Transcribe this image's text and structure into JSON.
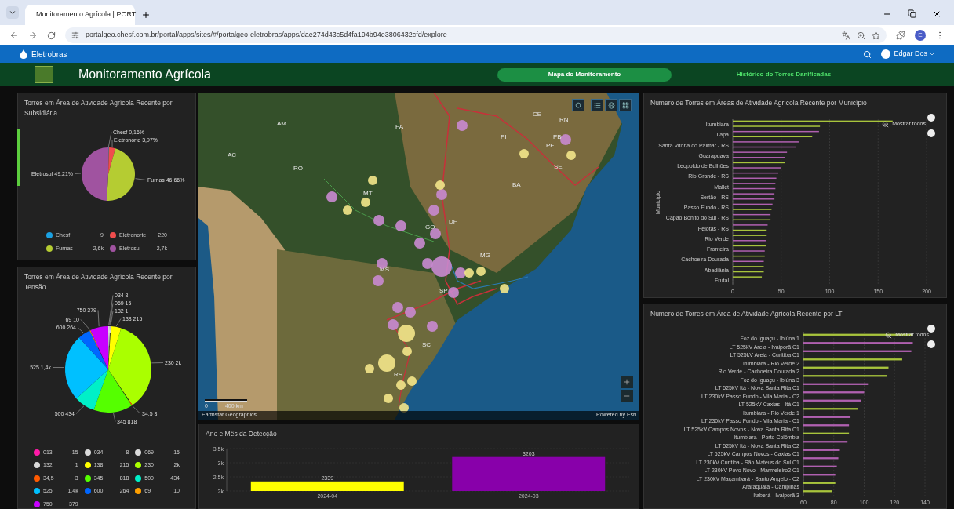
{
  "browser": {
    "tab_title": "Monitoramento Agrícola | PORT",
    "url": "portalgeo.chesf.com.br/portal/apps/sites/#/portalgeo-eletrobras/apps/dae274d43c5d4fa194b94e3806432cfd/explore",
    "profile_initial": "E"
  },
  "app_bar": {
    "brand": "Eletrobras",
    "user": "Edgar Dos"
  },
  "header": {
    "title": "Monitoramento Agrícola",
    "nav": [
      {
        "label": "Mapa do Monitoramento",
        "selected": true
      },
      {
        "label": "Histórico do Torres Danificadas",
        "selected": false
      }
    ]
  },
  "subsidiary_panel": {
    "title": "Torres em Área de Atividade Agrícola Recente por Subsidiária",
    "chart_data": {
      "type": "pie",
      "categories": [
        "Chesf",
        "Eletronorte",
        "Furnas",
        "Eletrosul"
      ],
      "colors": [
        "#1ba1e2",
        "#f04d4d",
        "#b5cc32",
        "#a053a0"
      ],
      "values": [
        0.16,
        3.97,
        46.66,
        49.21
      ],
      "value_labels": [
        "0,16%",
        "3,97%",
        "46,66%",
        "49,21%"
      ]
    },
    "legend": [
      {
        "label": "Chesf",
        "value": "9",
        "color": "#1ba1e2"
      },
      {
        "label": "Eletronorte",
        "value": "220",
        "color": "#f04d4d"
      },
      {
        "label": "Furnas",
        "value": "2,6k",
        "color": "#b5cc32"
      },
      {
        "label": "Eletrosul",
        "value": "2,7k",
        "color": "#a053a0"
      }
    ]
  },
  "voltage_panel": {
    "title": "Torres em Área de Atividade Agrícola Recente por Tensão",
    "chart_data": {
      "type": "pie",
      "categories": [
        "034",
        "069",
        "132",
        "138",
        "230",
        "34,5",
        "345",
        "500",
        "525",
        "600",
        "69",
        "750"
      ],
      "colors": [
        "#d9d9d9",
        "#d9d9d9",
        "#d9d9d9",
        "#ffff00",
        "#aaff00",
        "#ff5a00",
        "#55ff00",
        "#00f0c8",
        "#00c0ff",
        "#0066ff",
        "#ffa000",
        "#c800ff"
      ],
      "values": [
        8,
        15,
        1,
        215,
        2000,
        3,
        818,
        434,
        1400,
        264,
        10,
        379
      ],
      "value_labels": [
        "8",
        "15",
        "1",
        "215",
        "2k",
        "3",
        "818",
        "434",
        "1,4k",
        "264",
        "10",
        "379"
      ]
    },
    "legend": [
      {
        "label": "013",
        "value": "15",
        "color": "#ff1aa8"
      },
      {
        "label": "034",
        "value": "8",
        "color": "#d9d9d9"
      },
      {
        "label": "069",
        "value": "15",
        "color": "#d9d9d9"
      },
      {
        "label": "132",
        "value": "1",
        "color": "#d9d9d9"
      },
      {
        "label": "138",
        "value": "215",
        "color": "#ffff00"
      },
      {
        "label": "230",
        "value": "2k",
        "color": "#aaff00"
      },
      {
        "label": "34,5",
        "value": "3",
        "color": "#ff5a00"
      },
      {
        "label": "345",
        "value": "818",
        "color": "#55ff00"
      },
      {
        "label": "500",
        "value": "434",
        "color": "#00f0c8"
      },
      {
        "label": "525",
        "value": "1,4k",
        "color": "#00c0ff"
      },
      {
        "label": "600",
        "value": "264",
        "color": "#0066ff"
      },
      {
        "label": "69",
        "value": "10",
        "color": "#ffa000"
      },
      {
        "label": "750",
        "value": "379",
        "color": "#c800ff"
      }
    ]
  },
  "map": {
    "state_labels": [
      "AM",
      "PA",
      "AC",
      "RO",
      "MT",
      "GO",
      "DF",
      "MG",
      "BA",
      "PI",
      "CE",
      "RN",
      "PB",
      "PE",
      "SE",
      "SP",
      "MS",
      "SC",
      "RS"
    ],
    "scale_start": "0",
    "scale_end": "400 km",
    "attribution": "Earthstar Geographics",
    "powered_by": "Powered by Esri"
  },
  "detection_panel": {
    "title": "Ano e Mês da Detecção",
    "chart_data": {
      "type": "bar",
      "categories": [
        "2024-04",
        "2024-03"
      ],
      "colors": [
        "#ffff00",
        "#8800aa"
      ],
      "values": [
        2339,
        3203
      ],
      "ylim": [
        2000,
        3500
      ],
      "grid": true,
      "yticks": [
        {
          "value": 2000,
          "label": "2k"
        },
        {
          "value": 2500,
          "label": "2,5k"
        },
        {
          "value": 3000,
          "label": "3k"
        },
        {
          "value": 3500,
          "label": "3,5k"
        }
      ],
      "data_labels": true
    }
  },
  "municipality_panel": {
    "title": "Número de Torres em Áreas de Atividade Agrícola Recente por Município",
    "reset_button": "Mostrar todos",
    "chart_data": {
      "type": "bar",
      "orientation": "horizontal",
      "ylabel": "Município",
      "grid": true,
      "categories": [
        "Itumbiara",
        null,
        "Lapa",
        null,
        "Santa Vitória do Palmar - RS",
        null,
        "Guarapuava",
        null,
        "Leopoldo de Bulhões",
        null,
        "Rio Grande - RS",
        null,
        "Mallet",
        null,
        "Sertão - RS",
        null,
        "Passo Fundo - RS",
        null,
        "Capão Bonito do Sul - RS",
        null,
        "Pelotas - RS",
        null,
        "Rio Verde",
        null,
        "Fronteira",
        null,
        "Cachoeira Dourada",
        null,
        "Abadiânia",
        null,
        "Frutal"
      ],
      "series": [
        {
          "color": "#a8c43c",
          "values": [
            165,
            90,
            null,
            82,
            null,
            null,
            null,
            null,
            54,
            null,
            null,
            null,
            null,
            null,
            null,
            null,
            null,
            40,
            null,
            39,
            null,
            35,
            35,
            null,
            34,
            null,
            33,
            null,
            32,
            32,
            30
          ]
        },
        {
          "color": "#b060b0",
          "values": [
            null,
            null,
            89,
            null,
            68,
            65,
            56,
            54,
            null,
            50,
            47,
            45,
            44,
            44,
            43,
            43,
            41,
            null,
            39,
            null,
            36,
            null,
            null,
            34,
            null,
            33,
            null,
            32,
            null,
            null,
            null
          ]
        }
      ],
      "xlim": [
        0,
        200
      ],
      "xticks": [
        0,
        50,
        100,
        150,
        200
      ]
    }
  },
  "line_panel": {
    "title": "Número de Torres em Área de Atividade Agrícola Recente por LT",
    "reset_button": "Mostrar todos",
    "chart_data": {
      "type": "bar",
      "orientation": "horizontal",
      "grid": true,
      "categories": [
        "Foz do Iguaçu - Ibiúna 1",
        "LT 525kV Areia - Ivaiporã C1",
        "LT 525kV Areia - Curitiba C1",
        "Itumbiara - Rio Verde 2",
        "Rio Verde - Cachoeira Dourada 2",
        "Foz do Iguaçu - Ibiúna 3",
        "LT 525kV Itá - Nova Santa Rita C1",
        "LT 230kV Passo Fundo - Vila Maria - C2",
        "LT 525kV Caxias - Itá C1",
        "Itumbiara - Rio Verde 1",
        "LT 230kV Passo Fundo - Vila Maria - C1",
        "LT 525kV Campos Novos - Nova Santa Rita C1",
        "Itumbiara - Porto Colômbia",
        "LT 525kV Itá - Nova Santa Rita C2",
        "LT 525kV Campos Novos - Caxias C1",
        "LT 230kV Curitiba - São Mateus do Sul C1",
        "LT 230kV Povo Novo - Marmeleiro2 C1",
        "LT 230kV Maçambará - Santo Angelo - C2",
        "Araraquara - Campinas",
        "Itaberá - Ivaiporã 3"
      ],
      "series": [
        {
          "color": "#a8c43c",
          "values": [
            132,
            null,
            null,
            125,
            116,
            115,
            null,
            null,
            null,
            96,
            null,
            null,
            90,
            null,
            null,
            null,
            null,
            null,
            81,
            79
          ]
        },
        {
          "color": "#b060b0",
          "values": [
            null,
            132,
            131,
            null,
            null,
            null,
            103,
            100,
            98,
            null,
            91,
            90,
            null,
            89,
            84,
            83,
            82,
            81,
            null,
            null
          ]
        }
      ],
      "xlim": [
        60,
        140
      ],
      "xticks": [
        60,
        80,
        100,
        120,
        140
      ]
    }
  }
}
